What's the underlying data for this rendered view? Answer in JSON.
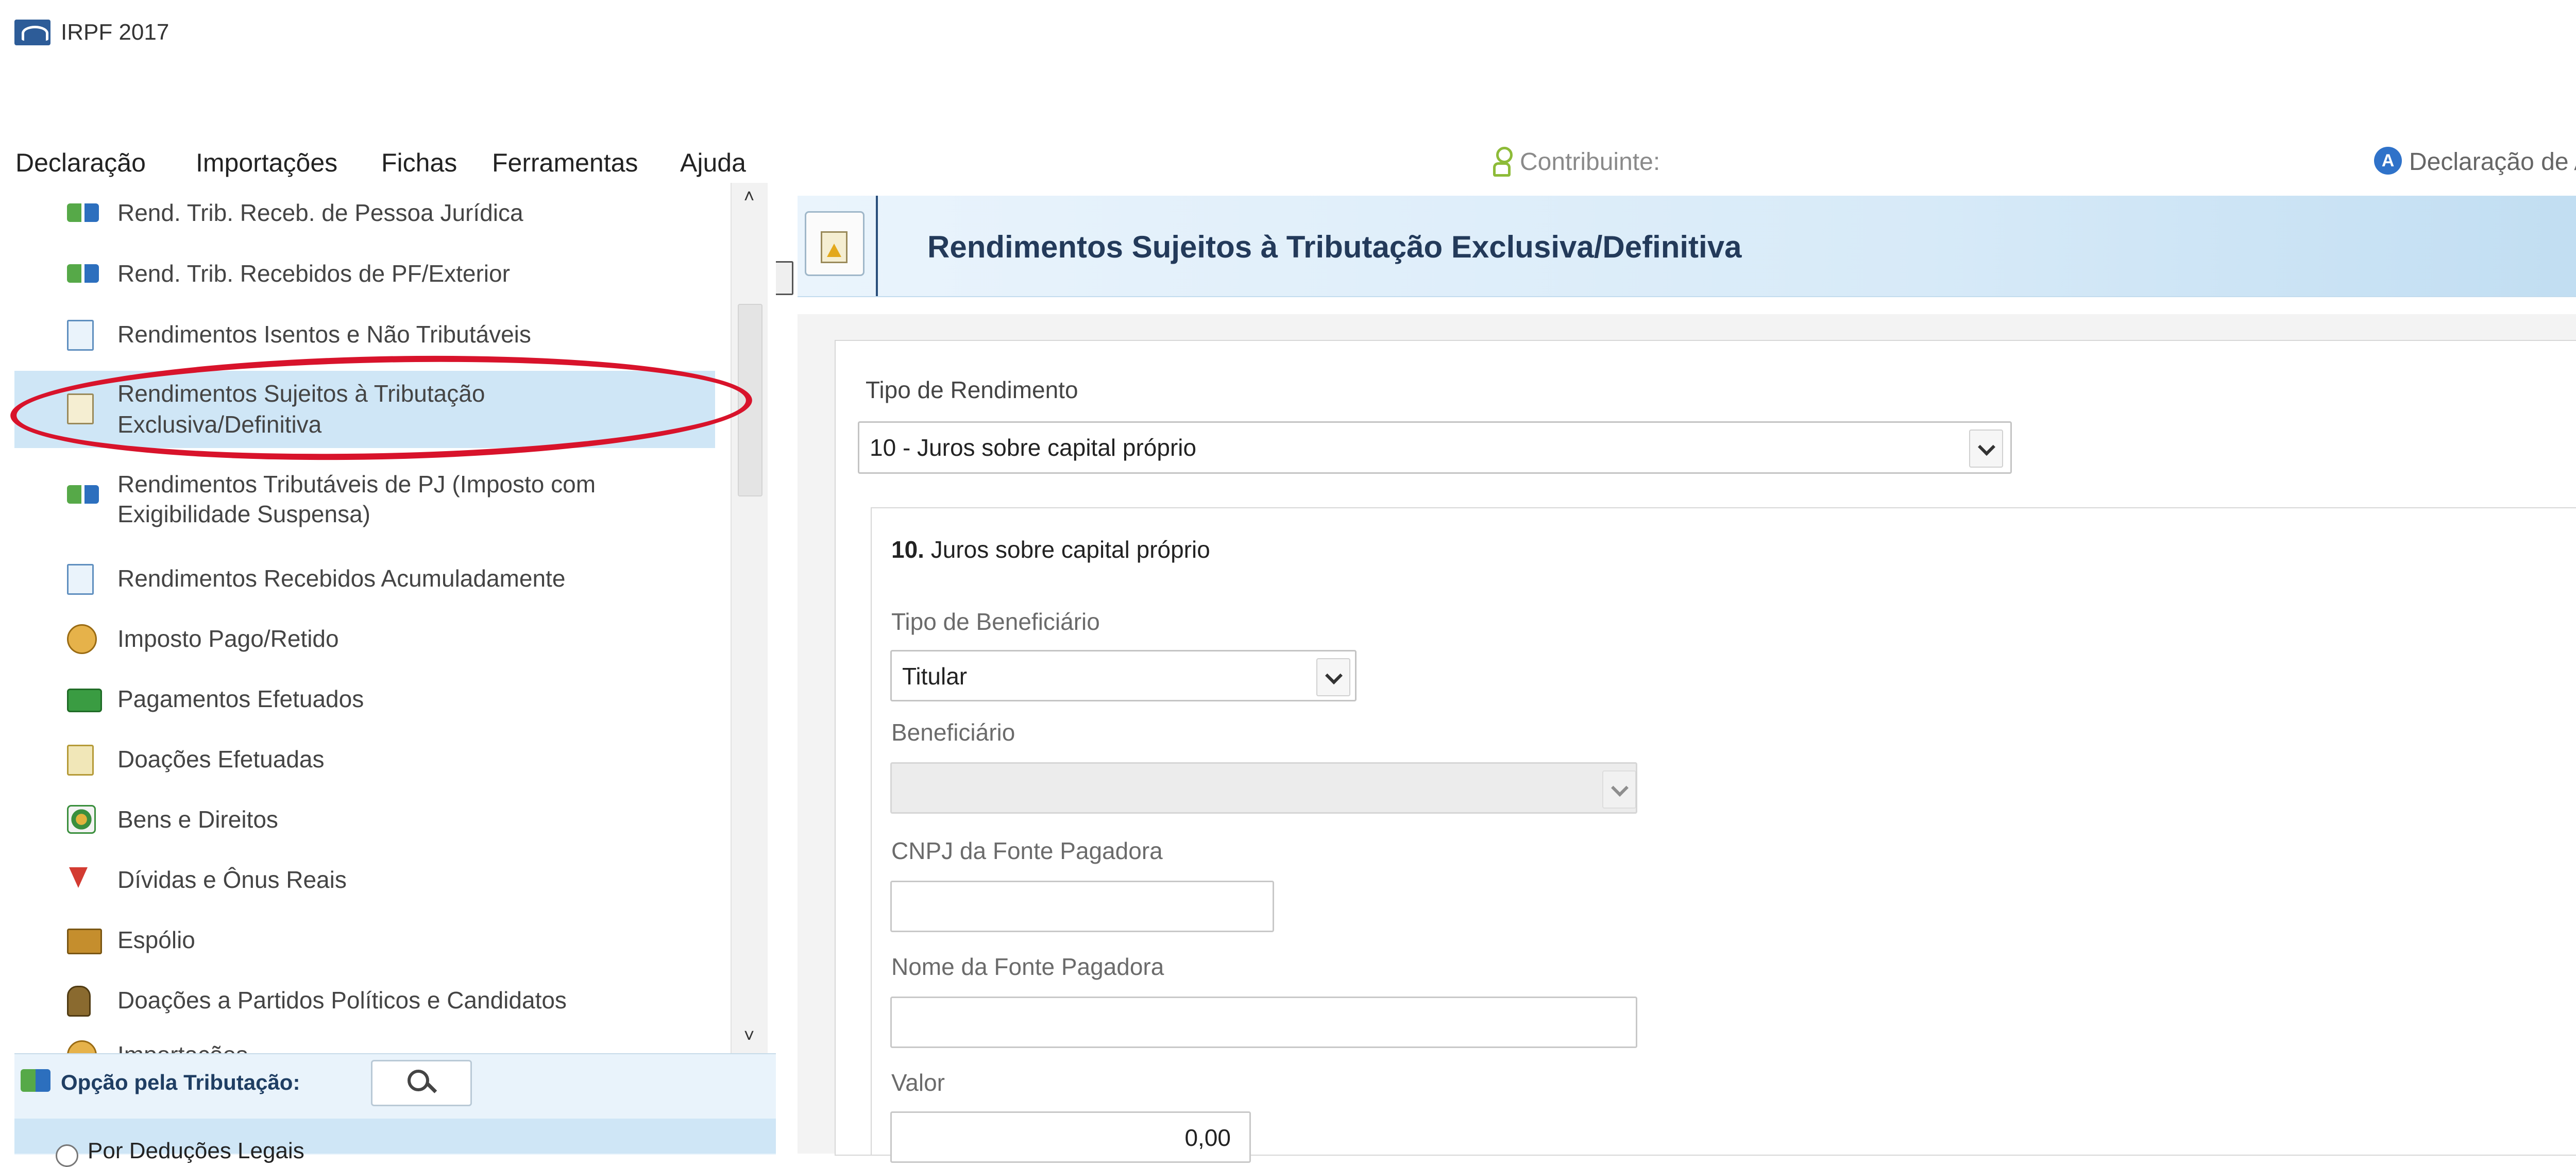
{
  "window": {
    "title": "IRPF 2017"
  },
  "menu": {
    "items": [
      "Declaração",
      "Importações",
      "Fichas",
      "Ferramentas",
      "Ajuda"
    ],
    "contributor_label": "Contribuinte:",
    "declaration_label": "Declaração de Ajuste"
  },
  "toolbar": {
    "icons": [
      "new-document-icon",
      "open-folder-icon",
      "folder-icon",
      "trash-icon",
      "globe-eye-icon",
      "globe-search-icon",
      "world-icon",
      "printer-icon",
      "check-icon",
      "calculator-icon",
      "book-icon"
    ]
  },
  "nav": {
    "items": [
      "Rend. Trib. Receb. de Pessoa Jurídica",
      "Rend. Trib. Recebidos de PF/Exterior",
      "Rendimentos Isentos e Não Tributáveis",
      "Rendimentos Sujeitos à Tributação Exclusiva/Definitiva",
      "Rendimentos Tributáveis de PJ (Imposto com Exigibilidade Suspensa)",
      "Rendimentos Recebidos Acumuladamente",
      "Imposto Pago/Retido",
      "Pagamentos Efetuados",
      "Doações Efetuadas",
      "Bens e Direitos",
      "Dívidas e Ônus Reais",
      "Espólio",
      "Doações a Partidos Políticos e Candidatos",
      "Importações"
    ],
    "selected_line1": "Rendimentos Sujeitos à Tributação",
    "selected_line2": "Exclusiva/Definitiva",
    "pj_line1": "Rendimentos Tributáveis de PJ (Imposto com",
    "pj_line2": "Exigibilidade Suspensa)",
    "annotation_color": "#d8132b"
  },
  "option": {
    "label": "Opção pela Tributação:",
    "radio_label": "Por Deduções Legais"
  },
  "main": {
    "title": "Rendimentos Sujeitos à Tributação Exclusiva/Definitiva",
    "tipo_rendimento_label": "Tipo de Rendimento",
    "tipo_rendimento_value": "10 - Juros sobre capital próprio",
    "section_number": "10.",
    "section_title": "Juros sobre capital próprio",
    "tipo_beneficiario_label": "Tipo de Beneficiário",
    "tipo_beneficiario_value": "Titular",
    "beneficiario_label": "Beneficiário",
    "beneficiario_value": "",
    "cnpj_label": "CNPJ da Fonte Pagadora",
    "cnpj_value": "",
    "nome_label": "Nome da Fonte Pagadora",
    "nome_value": "",
    "valor_label": "Valor",
    "valor_value": "0,00"
  },
  "colors": {
    "header_title": "#233a5a",
    "selected_bg": "#cfe6f6",
    "accent_blue": "#2f72c9"
  }
}
